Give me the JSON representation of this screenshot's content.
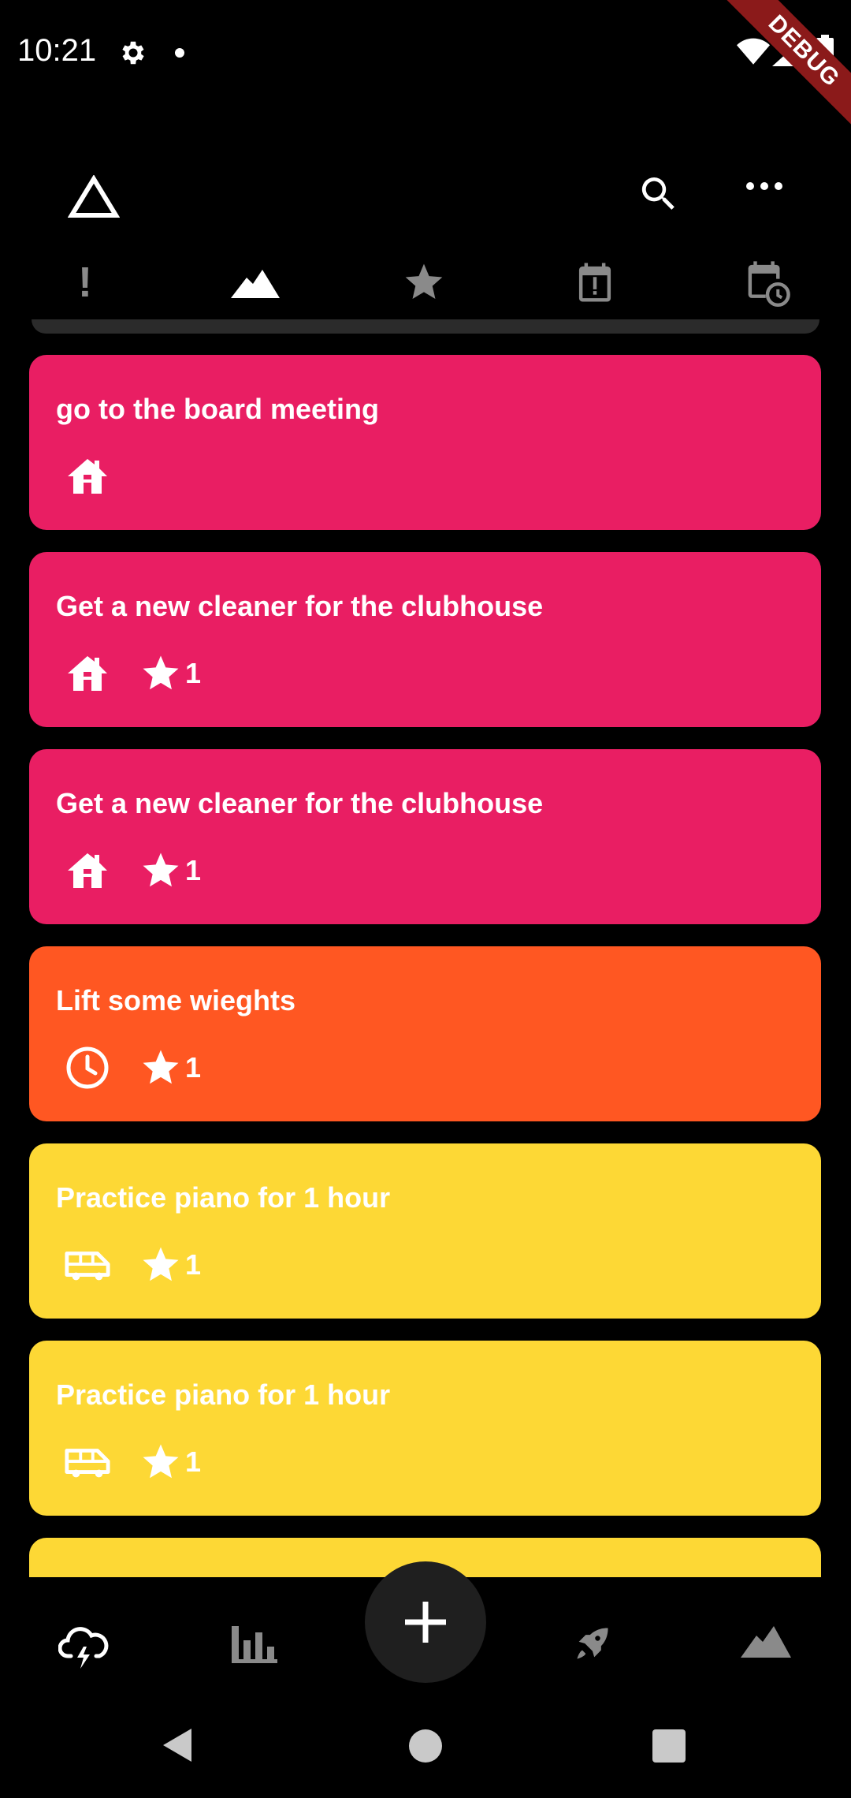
{
  "status_bar": {
    "time": "10:21",
    "debug_label": "DEBUG"
  },
  "app_bar": {
    "logo_icon": "triangle-outline-icon",
    "actions": [
      "search-icon",
      "more-horiz-icon"
    ]
  },
  "filter_tabs": [
    {
      "icon": "exclamation-icon",
      "label": "!",
      "selected": false
    },
    {
      "icon": "mountain-icon",
      "selected": true
    },
    {
      "icon": "star-icon",
      "selected": false
    },
    {
      "icon": "calendar-alert-icon",
      "selected": false
    },
    {
      "icon": "calendar-clock-icon",
      "selected": false
    }
  ],
  "colors": {
    "pink": "#e91e63",
    "orange": "#ff5722",
    "yellow": "#fdd835",
    "background": "#000000",
    "tab_inactive": "#8a8a8a"
  },
  "tasks": [
    {
      "title": "go to the board meeting",
      "category_icon": "house-icon",
      "star_count": null,
      "color": "#e91e63"
    },
    {
      "title": "Get a new cleaner for the clubhouse",
      "category_icon": "house-icon",
      "star_count": "1",
      "color": "#e91e63"
    },
    {
      "title": "Get a new cleaner for the clubhouse",
      "category_icon": "house-icon",
      "star_count": "1",
      "color": "#e91e63"
    },
    {
      "title": "Lift some wieghts",
      "category_icon": "clock-icon",
      "star_count": "1",
      "color": "#ff5722"
    },
    {
      "title": "Practice piano for 1 hour",
      "category_icon": "van-icon",
      "star_count": "1",
      "color": "#fdd835"
    },
    {
      "title": "Practice piano for 1 hour",
      "category_icon": "van-icon",
      "star_count": "1",
      "color": "#fdd835"
    }
  ],
  "bottom_nav": [
    {
      "icon": "cloud-lightning-icon"
    },
    {
      "icon": "bar-chart-icon"
    },
    {
      "icon": "add-icon",
      "is_fab": true
    },
    {
      "icon": "rocket-icon"
    },
    {
      "icon": "mountain-icon"
    }
  ]
}
